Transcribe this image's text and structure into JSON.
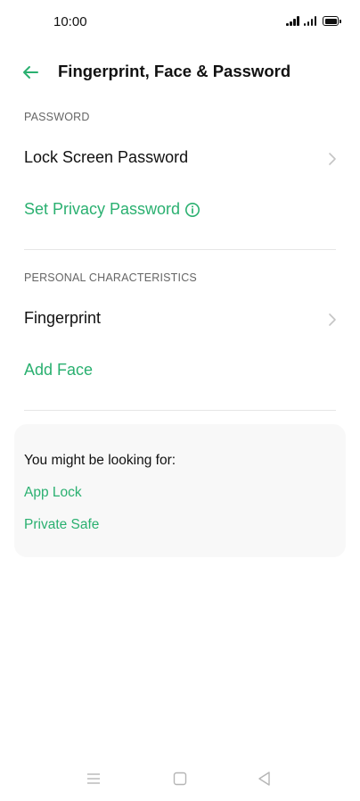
{
  "status_bar": {
    "time": "10:00"
  },
  "header": {
    "title": "Fingerprint, Face & Password"
  },
  "sections": {
    "password": {
      "header": "PASSWORD",
      "lock_screen_password": "Lock Screen Password",
      "set_privacy_password": "Set Privacy Password"
    },
    "personal": {
      "header": "PERSONAL CHARACTERISTICS",
      "fingerprint": "Fingerprint",
      "add_face": "Add Face"
    }
  },
  "suggestions": {
    "title": "You might be looking for:",
    "links": [
      "App Lock",
      "Private Safe"
    ]
  },
  "colors": {
    "accent": "#2ab070",
    "text": "#111111",
    "muted": "#666666",
    "card_bg": "#f8f8f8"
  },
  "icons": {
    "back": "back-arrow-icon",
    "chevron": "chevron-right-icon",
    "info": "info-icon",
    "nav_menu": "menu-icon",
    "nav_home": "home-square-icon",
    "nav_back": "back-triangle-icon"
  }
}
